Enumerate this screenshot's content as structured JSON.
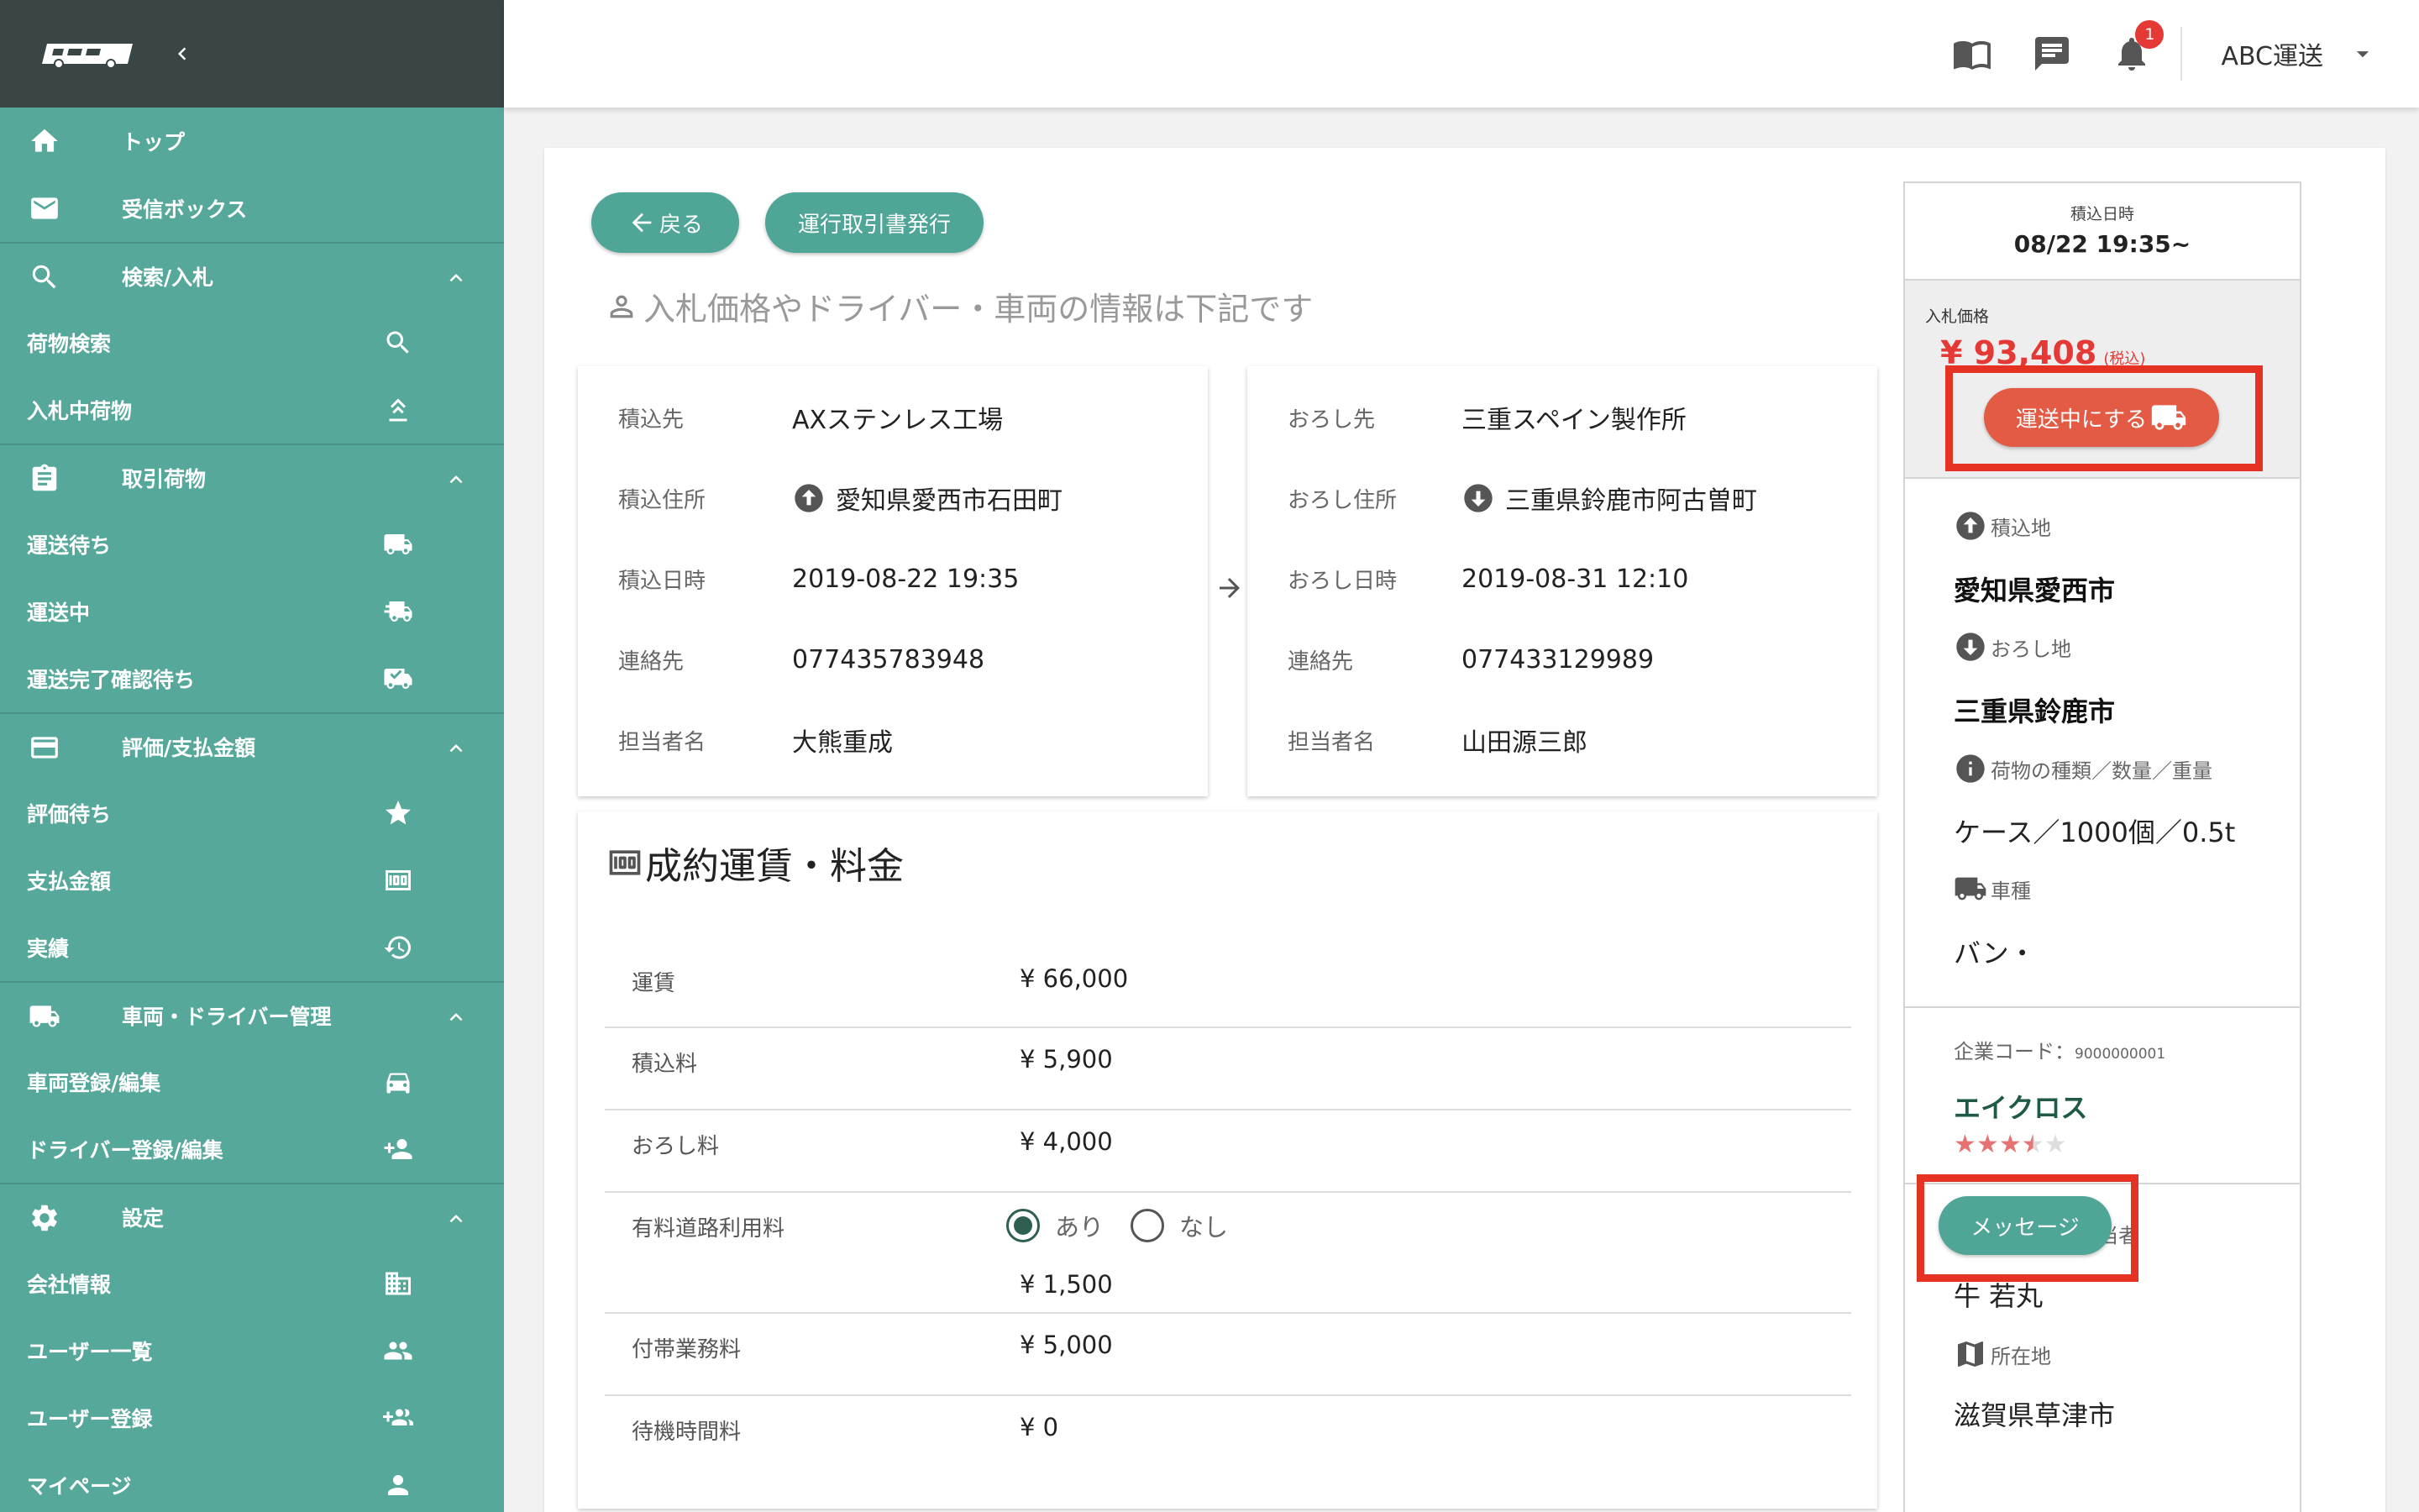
{
  "sidebar": {
    "items": [
      {
        "label": "トップ",
        "icon": "home-icon",
        "type": "top"
      },
      {
        "label": "受信ボックス",
        "icon": "mail-icon",
        "type": "top"
      },
      {
        "label": "検索/入札",
        "icon": "search-icon",
        "type": "section"
      },
      {
        "label": "荷物検索",
        "icon": "search-icon",
        "type": "sub"
      },
      {
        "label": "入札中荷物",
        "icon": "gavel-icon",
        "type": "sub"
      },
      {
        "label": "取引荷物",
        "icon": "clipboard-icon",
        "type": "section"
      },
      {
        "label": "運送待ち",
        "icon": "truck-icon",
        "type": "sub"
      },
      {
        "label": "運送中",
        "icon": "truck-fast-icon",
        "type": "sub"
      },
      {
        "label": "運送完了確認待ち",
        "icon": "truck-check-icon",
        "type": "sub"
      },
      {
        "label": "評価/支払金額",
        "icon": "credit-card-icon",
        "type": "section"
      },
      {
        "label": "評価待ち",
        "icon": "star-icon",
        "type": "sub"
      },
      {
        "label": "支払金額",
        "icon": "money-icon",
        "type": "sub"
      },
      {
        "label": "実績",
        "icon": "history-icon",
        "type": "sub"
      },
      {
        "label": "車両・ドライバー管理",
        "icon": "truck-icon",
        "type": "section"
      },
      {
        "label": "車両登録/編集",
        "icon": "car-icon",
        "type": "sub"
      },
      {
        "label": "ドライバー登録/編集",
        "icon": "person-add-icon",
        "type": "sub"
      },
      {
        "label": "設定",
        "icon": "gear-icon",
        "type": "section"
      },
      {
        "label": "会社情報",
        "icon": "building-icon",
        "type": "sub"
      },
      {
        "label": "ユーザー一覧",
        "icon": "people-icon",
        "type": "sub"
      },
      {
        "label": "ユーザー登録",
        "icon": "group-add-icon",
        "type": "sub"
      },
      {
        "label": "マイページ",
        "icon": "person-icon",
        "type": "sub"
      }
    ]
  },
  "appbar": {
    "notification_count": "1",
    "account_name": "ABC運送",
    "icons": [
      "book-icon",
      "message-icon",
      "bell-icon"
    ]
  },
  "actions": {
    "back": "戻る",
    "issue_doc": "運行取引書発行"
  },
  "subtitle": "入札価格やドライバー・車両の情報は下記です",
  "loading": {
    "rows": [
      {
        "key": "積込先",
        "value": "AXステンレス工場"
      },
      {
        "key": "積込住所",
        "value": "愛知県愛西市石田町",
        "icon": "arrow-up-circle-icon"
      },
      {
        "key": "積込日時",
        "value": "2019-08-22 19:35"
      },
      {
        "key": "連絡先",
        "value": "077435783948"
      },
      {
        "key": "担当者名",
        "value": "大熊重成"
      }
    ]
  },
  "unloading": {
    "rows": [
      {
        "key": "おろし先",
        "value": "三重スペイン製作所"
      },
      {
        "key": "おろし住所",
        "value": "三重県鈴鹿市阿古曽町",
        "icon": "arrow-down-circle-icon"
      },
      {
        "key": "おろし日時",
        "value": "2019-08-31 12:10"
      },
      {
        "key": "連絡先",
        "value": "077433129989"
      },
      {
        "key": "担当者名",
        "value": "山田源三郎"
      }
    ]
  },
  "fees": {
    "title": "成約運賃・料金",
    "rows": [
      {
        "key": "運賃",
        "value": "¥ 66,000"
      },
      {
        "key": "積込料",
        "value": "¥ 5,900"
      },
      {
        "key": "おろし料",
        "value": "¥ 4,000"
      },
      {
        "key": "有料道路利用料",
        "value": "¥ 1,500"
      },
      {
        "key": "付帯業務料",
        "value": "¥ 5,000"
      },
      {
        "key": "待機時間料",
        "value": "¥ 0"
      }
    ],
    "toll_options": [
      "あり",
      "なし"
    ],
    "toll_selected": "あり"
  },
  "right": {
    "load_datetime_label": "積込日時",
    "load_datetime": "08/22 19:35~",
    "bid_label": "入札価格",
    "bid_price": "¥ 93,408",
    "tax_note": "(税込)",
    "in_transit_button": "運送中にする",
    "origin_label": "積込地",
    "origin": "愛知県愛西市",
    "dest_label": "おろし地",
    "dest": "三重県鈴鹿市",
    "cargo_label": "荷物の種類／数量／重量",
    "cargo": "ケース／1000個／0.5t",
    "vehicle_label": "車種",
    "vehicle": "バン・",
    "company_code_label": "企業コード：",
    "company_code": "9000000001",
    "company_name": "エイクロス",
    "rating": 3.5,
    "message_button": "メッセージ",
    "manager_label": "責任者名/担当者",
    "manager": "牛 若丸",
    "location_label": "所在地",
    "location": "滋賀県草津市"
  },
  "colors": {
    "sidebar": "#56a89b",
    "sidebar_header": "#3a4546",
    "accent_teal": "#4fa596",
    "price_red": "#e53935",
    "highlight_red": "#e53222"
  }
}
